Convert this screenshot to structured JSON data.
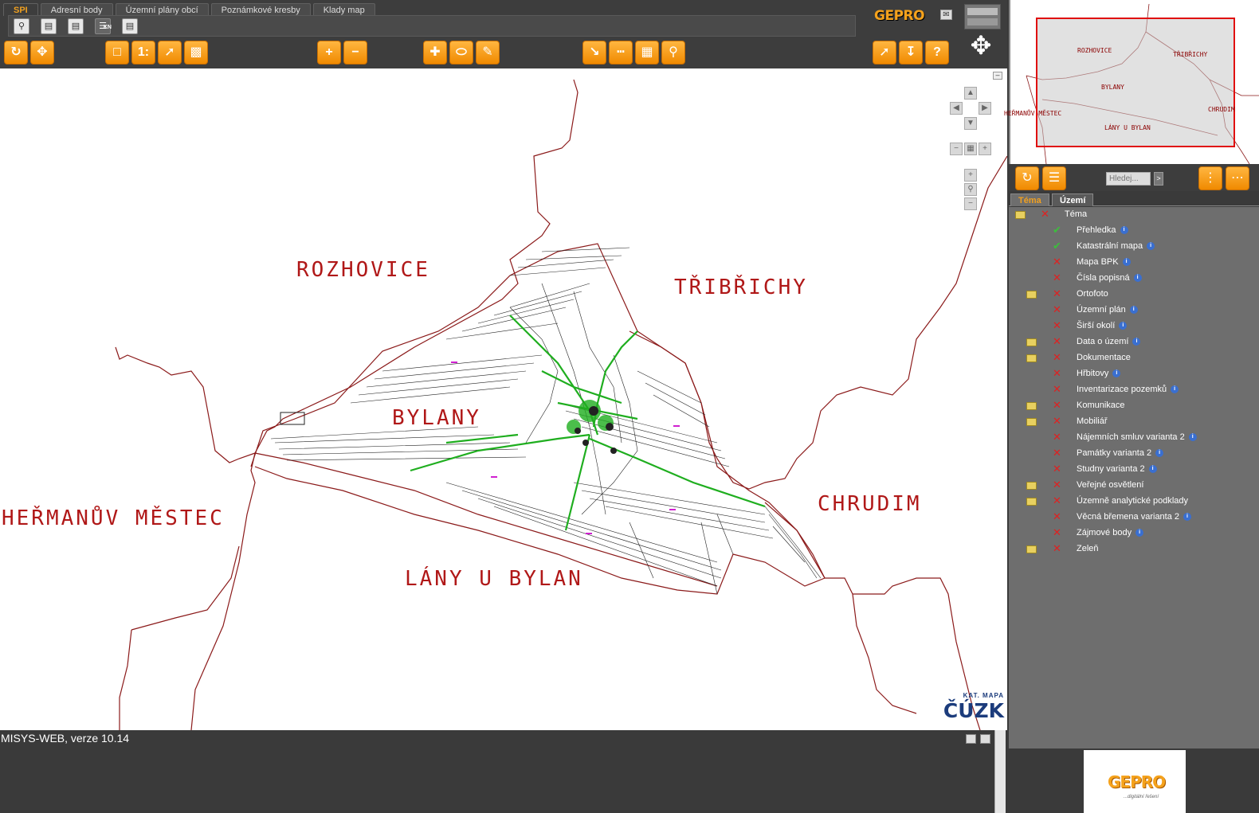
{
  "tabs": [
    "SPI",
    "Adresní body",
    "Územní plány obcí",
    "Poznámkové kresby",
    "Klady map"
  ],
  "active_tab": "SPI",
  "header": {
    "brand": "GEPRO"
  },
  "subtoolbar": {
    "kn_label": "KN"
  },
  "toolbar_icons": [
    "select-area-icon",
    "select-point-icon",
    "zoom-extent-icon",
    "scale-icon",
    "measure-icon",
    "print-area-icon",
    "zoom-in-icon",
    "zoom-out-icon",
    "add-point-icon",
    "draw-polygon-icon",
    "edit-note-icon",
    "identify-icon",
    "measure-distance-icon",
    "measure-area-icon",
    "find-icon",
    "gps-icon",
    "save-icon",
    "help-icon"
  ],
  "map": {
    "labels": [
      "ROZHOVICE",
      "TŘIBŘICHY",
      "BYLANY",
      "HEŘMANŮV MĚSTEC",
      "CHRUDIM",
      "LÁNY U BYLAN"
    ],
    "logo_sub": "KAT. MAPA",
    "logo_main": "ČÚZK",
    "boundary_color": "#8b1a1a",
    "road_color": "#1fae1f"
  },
  "status": {
    "text": "MISYS-WEB, verze 10.14"
  },
  "overview": {
    "labels": [
      "ROZHOVICE",
      "TŘIBŘICHY",
      "BYLANY",
      "HEŘMANŮV MĚSTEC",
      "CHRUDIM",
      "LÁNY U BYLAN"
    ],
    "viewport_color": "#e01010"
  },
  "panel": {
    "search_placeholder": "Hledej...",
    "search_go": ">",
    "tabs": [
      "Téma",
      "Území"
    ],
    "active_tab": "Téma",
    "root": "Téma",
    "layers": [
      {
        "name": "Přehledka",
        "visible": true,
        "info": true,
        "folder": false
      },
      {
        "name": "Katastrální mapa",
        "visible": true,
        "info": true,
        "folder": false
      },
      {
        "name": "Mapa BPK",
        "visible": false,
        "info": true,
        "folder": false
      },
      {
        "name": "Čísla popisná",
        "visible": false,
        "info": true,
        "folder": false
      },
      {
        "name": "Ortofoto",
        "visible": false,
        "info": false,
        "folder": true
      },
      {
        "name": "Územní plán",
        "visible": false,
        "info": true,
        "folder": false
      },
      {
        "name": "Širší okolí",
        "visible": false,
        "info": true,
        "folder": false
      },
      {
        "name": "Data o území",
        "visible": false,
        "info": true,
        "folder": true
      },
      {
        "name": "Dokumentace",
        "visible": false,
        "info": false,
        "folder": true
      },
      {
        "name": "Hřbitovy",
        "visible": false,
        "info": true,
        "folder": false
      },
      {
        "name": "Inventarizace pozemků",
        "visible": false,
        "info": true,
        "folder": false
      },
      {
        "name": "Komunikace",
        "visible": false,
        "info": false,
        "folder": true
      },
      {
        "name": "Mobiliář",
        "visible": false,
        "info": false,
        "folder": true
      },
      {
        "name": "Nájemních smluv varianta 2",
        "visible": false,
        "info": true,
        "folder": false
      },
      {
        "name": "Památky varianta 2",
        "visible": false,
        "info": true,
        "folder": false
      },
      {
        "name": "Studny varianta 2",
        "visible": false,
        "info": true,
        "folder": false
      },
      {
        "name": "Veřejné osvětlení",
        "visible": false,
        "info": false,
        "folder": true
      },
      {
        "name": "Územně analytické podklady",
        "visible": false,
        "info": false,
        "folder": true
      },
      {
        "name": "Věcná břemena varianta 2",
        "visible": false,
        "info": true,
        "folder": false
      },
      {
        "name": "Zájmové body",
        "visible": false,
        "info": true,
        "folder": false
      },
      {
        "name": "Zeleň",
        "visible": false,
        "info": false,
        "folder": true
      }
    ],
    "footer_brand": "GEPRO",
    "footer_tagline": "...digitální řešení"
  }
}
